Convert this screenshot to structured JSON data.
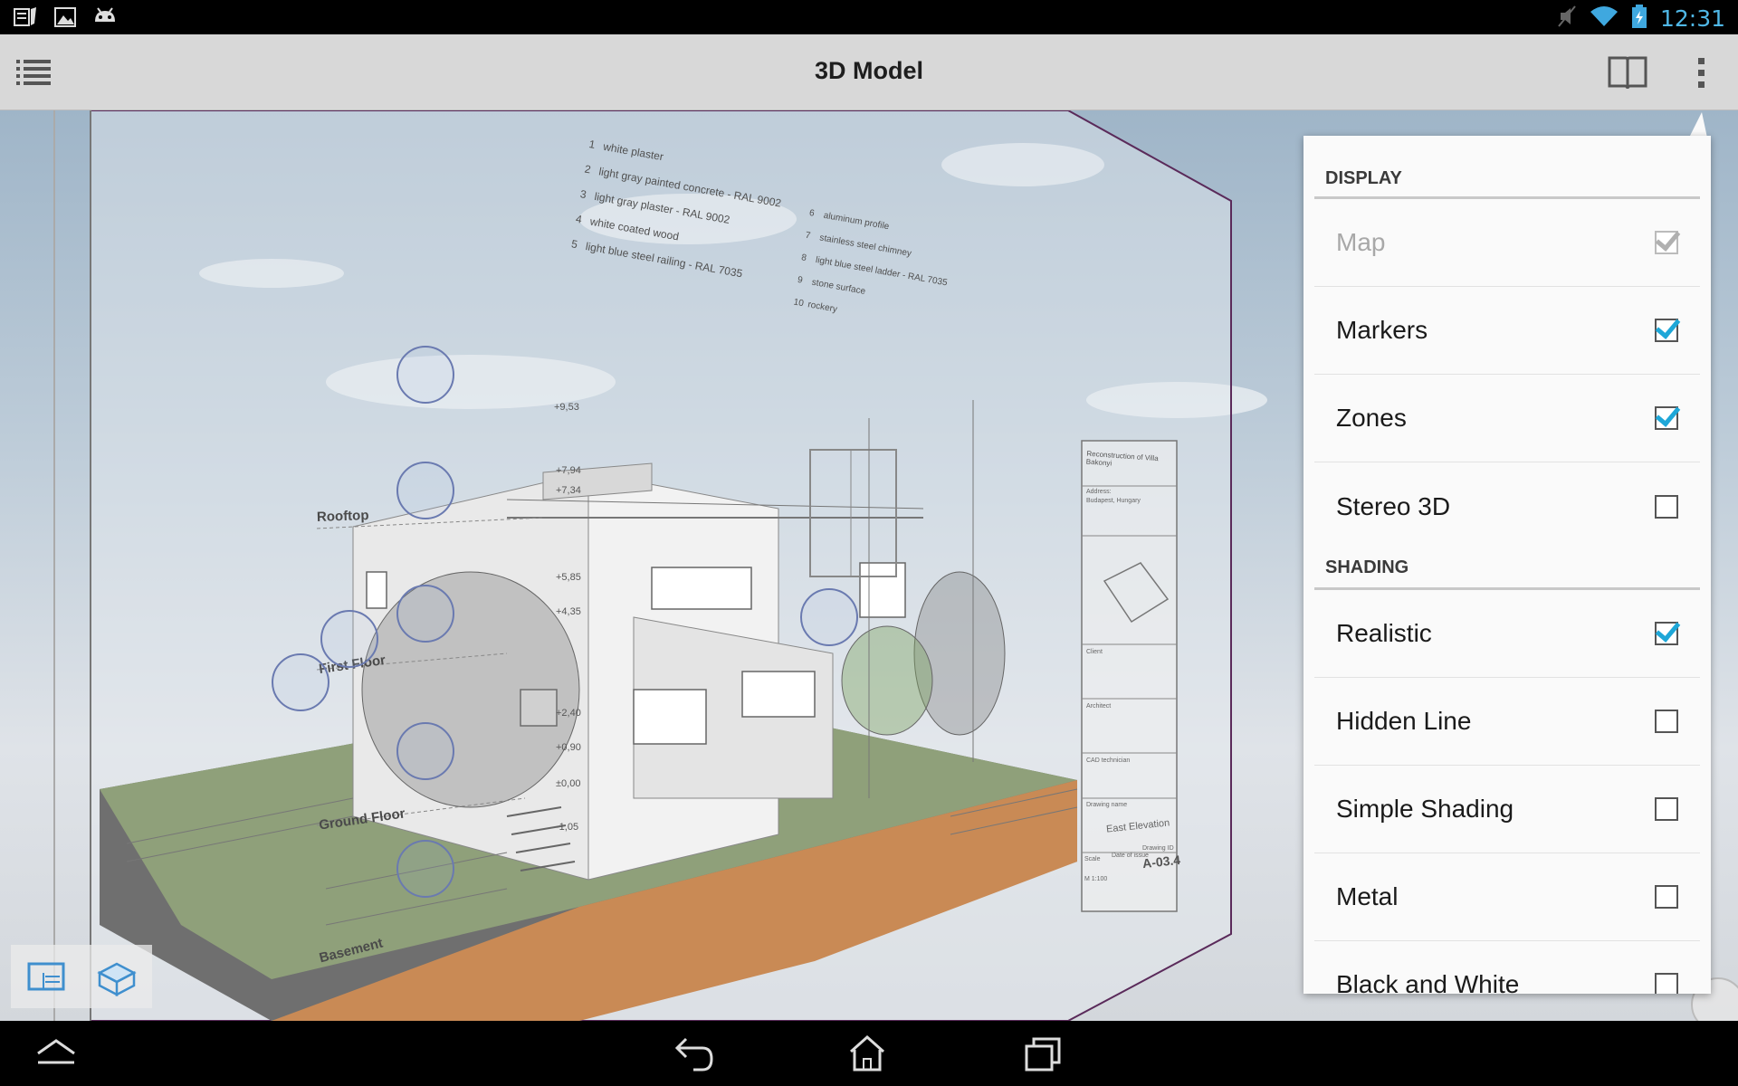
{
  "status_bar": {
    "time": "12:31",
    "left_icons": [
      "notes-icon",
      "image-icon",
      "android-icon"
    ],
    "right_icons": [
      "mute-icon",
      "wifi-icon",
      "battery-charging-icon"
    ]
  },
  "action_bar": {
    "title": "3D Model",
    "menu_icon": "list-icon",
    "book_icon": "book-icon",
    "overflow_icon": "overflow-icon"
  },
  "scene": {
    "floor_labels": [
      "Rooftop",
      "First Floor",
      "Ground Floor",
      "Basement"
    ],
    "legend_left": [
      {
        "n": "1",
        "text": "white plaster"
      },
      {
        "n": "2",
        "text": "light gray painted concrete - RAL 9002"
      },
      {
        "n": "3",
        "text": "light gray plaster - RAL 9002"
      },
      {
        "n": "4",
        "text": "white coated wood"
      },
      {
        "n": "5",
        "text": "light blue steel railing - RAL 7035"
      }
    ],
    "legend_right": [
      {
        "n": "6",
        "text": "aluminum profile"
      },
      {
        "n": "7",
        "text": "stainless steel chimney"
      },
      {
        "n": "8",
        "text": "light blue steel ladder - RAL 7035"
      },
      {
        "n": "9",
        "text": "stone surface"
      },
      {
        "n": "10",
        "text": "rockery"
      }
    ],
    "title_block": {
      "project": "Reconstruction of Villa Bakonyi",
      "address_label": "Address:",
      "address": "Budapest, Hungary",
      "client_label": "Client",
      "architect_label": "Architect",
      "cad_label": "CAD technician",
      "drawing_name_label": "Drawing name",
      "drawing_name": "East Elevation",
      "scale_label": "Scale",
      "scale": "M 1:100",
      "date_label": "Date of issue",
      "drawing_no_label": "Drawing ID",
      "drawing_no": "A-03.4"
    },
    "elevations": [
      "+9,53",
      "+7,94",
      "+7,34",
      "+5,85",
      "+4,35",
      "+2,40",
      "+0,90",
      "±0,00",
      "-1,05"
    ]
  },
  "view_toggles": [
    "sheet-view-icon",
    "box-view-icon"
  ],
  "menu": {
    "sections": [
      {
        "header": "DISPLAY",
        "items": [
          {
            "label": "Map",
            "checked": true,
            "disabled": true
          },
          {
            "label": "Markers",
            "checked": true,
            "disabled": false
          },
          {
            "label": "Zones",
            "checked": true,
            "disabled": false
          },
          {
            "label": "Stereo 3D",
            "checked": false,
            "disabled": false
          }
        ]
      },
      {
        "header": "SHADING",
        "items": [
          {
            "label": "Realistic",
            "checked": true,
            "disabled": false
          },
          {
            "label": "Hidden Line",
            "checked": false,
            "disabled": false
          },
          {
            "label": "Simple Shading",
            "checked": false,
            "disabled": false
          },
          {
            "label": "Metal",
            "checked": false,
            "disabled": false
          },
          {
            "label": "Black and White",
            "checked": false,
            "disabled": false
          }
        ]
      }
    ]
  },
  "nav_bar": [
    "up-icon",
    "back-icon",
    "home-icon",
    "recent-apps-icon"
  ],
  "colors": {
    "accent": "#1ea7d8",
    "action_bar": "#d8d8d8",
    "menu_bg": "#fafafa",
    "grass": "#8fa07a",
    "wood": "#c98a55"
  }
}
